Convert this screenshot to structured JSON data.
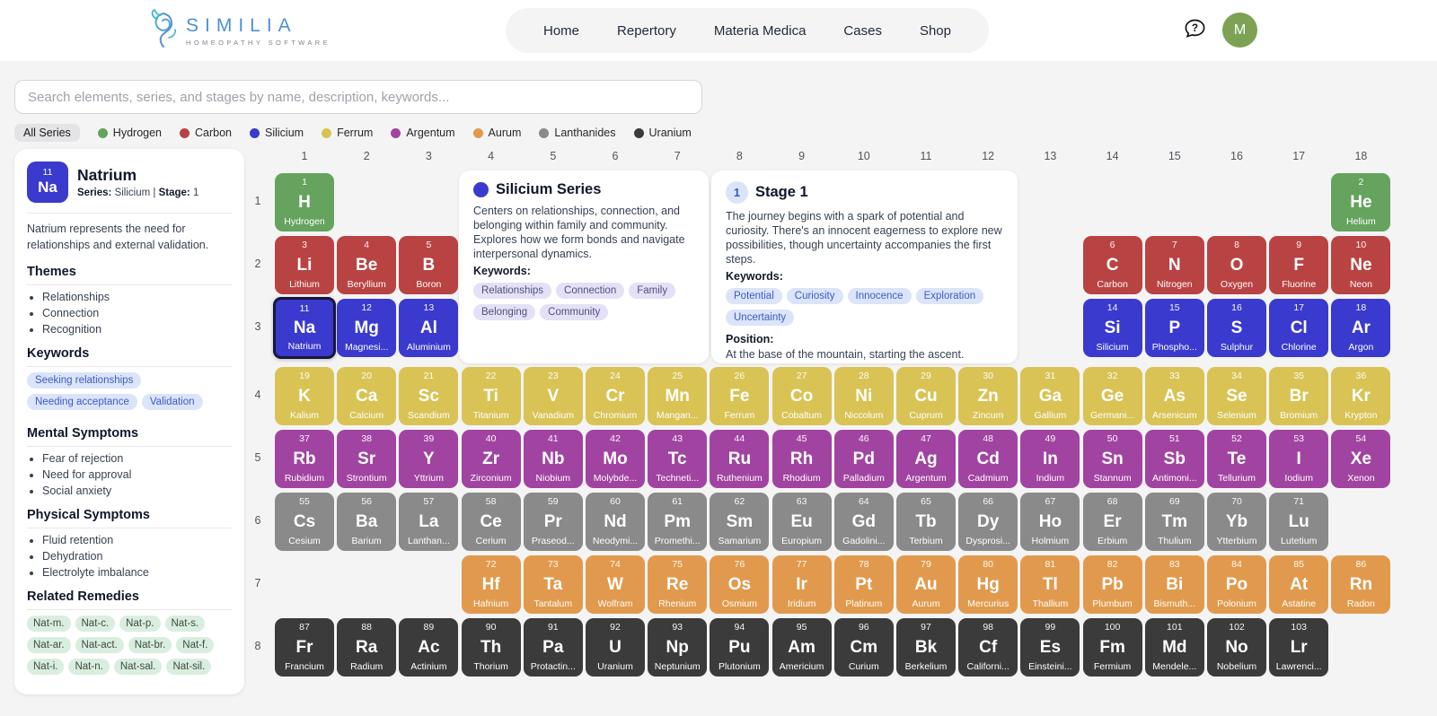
{
  "header": {
    "logo_title": "SIMILIA",
    "logo_subtitle": "HOMEOPATHY SOFTWARE",
    "nav": [
      "Home",
      "Repertory",
      "Materia Medica",
      "Cases",
      "Shop"
    ],
    "help_icon": "question-bubble",
    "avatar_initial": "M",
    "avatar_color": "#7da253"
  },
  "search": {
    "placeholder": "Search elements, series, and stages by name, description, keywords..."
  },
  "legend": {
    "all_label": "All Series",
    "series": [
      {
        "name": "Hydrogen",
        "color": "#65a35f"
      },
      {
        "name": "Carbon",
        "color": "#b94343"
      },
      {
        "name": "Silicium",
        "color": "#3a3ace"
      },
      {
        "name": "Ferrum",
        "color": "#d9c355"
      },
      {
        "name": "Argentum",
        "color": "#a144a1"
      },
      {
        "name": "Aurum",
        "color": "#e19a4d"
      },
      {
        "name": "Lanthanides",
        "color": "#8a8a8a"
      },
      {
        "name": "Uranium",
        "color": "#3b3b3b"
      }
    ]
  },
  "detail_panel": {
    "number": "11",
    "symbol": "Na",
    "name": "Natrium",
    "series_label": "Series:",
    "series_value": "Silicium",
    "separator": "|",
    "stage_label": "Stage:",
    "stage_value": "1",
    "description": "Natrium represents the need for relationships and external validation.",
    "themes_title": "Themes",
    "themes": [
      "Relationships",
      "Connection",
      "Recognition"
    ],
    "keywords_title": "Keywords",
    "keywords": [
      "Seeking relationships",
      "Needing acceptance",
      "Validation"
    ],
    "mental_title": "Mental Symptoms",
    "mental": [
      "Fear of rejection",
      "Need for approval",
      "Social anxiety"
    ],
    "physical_title": "Physical Symptoms",
    "physical": [
      "Fluid retention",
      "Dehydration",
      "Electrolyte imbalance"
    ],
    "remedies_title": "Related Remedies",
    "remedies": [
      "Nat-m.",
      "Nat-c.",
      "Nat-p.",
      "Nat-s.",
      "Nat-ar.",
      "Nat-act.",
      "Nat-br.",
      "Nat-f.",
      "Nat-i.",
      "Nat-n.",
      "Nat-sal.",
      "Nat-sil."
    ]
  },
  "series_card": {
    "dot_color": "#3a3ace",
    "title": "Silicium Series",
    "description": "Centers on relationships, connection, and belonging within family and community. Explores how we form bonds and navigate interpersonal dynamics.",
    "keywords_label": "Keywords:",
    "keywords": [
      "Relationships",
      "Connection",
      "Family",
      "Belonging",
      "Community"
    ]
  },
  "stage_card": {
    "badge": "1",
    "title": "Stage 1",
    "description": "The journey begins with a spark of potential and curiosity. There's an innocent eagerness to explore new possibilities, though uncertainty accompanies the first steps.",
    "keywords_label": "Keywords:",
    "keywords": [
      "Potential",
      "Curiosity",
      "Innocence",
      "Exploration",
      "Uncertainty"
    ],
    "position_label": "Position:",
    "position": "At the base of the mountain, starting the ascent."
  },
  "table": {
    "col_headers": [
      "1",
      "2",
      "3",
      "4",
      "5",
      "6",
      "7",
      "8",
      "9",
      "10",
      "11",
      "12",
      "13",
      "14",
      "15",
      "16",
      "17",
      "18"
    ],
    "row_headers": [
      "1",
      "2",
      "3",
      "4",
      "5",
      "6",
      "7",
      "8"
    ],
    "series_colors": {
      "hydrogen": "#65a35f",
      "carbon": "#b94343",
      "silicium": "#3a3ace",
      "ferrum": "#d9c355",
      "argentum": "#a144a1",
      "lanthanides": "#8a8a8a",
      "aurum": "#e19a4d",
      "uranium": "#3b3b3b"
    },
    "selected": "Na",
    "element_fields": [
      "number",
      "symbol",
      "name",
      "row",
      "col",
      "series"
    ],
    "elements": [
      [
        1,
        "H",
        "Hydrogen",
        1,
        1,
        "hydrogen"
      ],
      [
        2,
        "He",
        "Helium",
        1,
        18,
        "hydrogen"
      ],
      [
        3,
        "Li",
        "Lithium",
        2,
        1,
        "carbon"
      ],
      [
        4,
        "Be",
        "Beryllium",
        2,
        2,
        "carbon"
      ],
      [
        5,
        "B",
        "Boron",
        2,
        3,
        "carbon"
      ],
      [
        6,
        "C",
        "Carbon",
        2,
        14,
        "carbon"
      ],
      [
        7,
        "N",
        "Nitrogen",
        2,
        15,
        "carbon"
      ],
      [
        8,
        "O",
        "Oxygen",
        2,
        16,
        "carbon"
      ],
      [
        9,
        "F",
        "Fluorine",
        2,
        17,
        "carbon"
      ],
      [
        10,
        "Ne",
        "Neon",
        2,
        18,
        "carbon"
      ],
      [
        11,
        "Na",
        "Natrium",
        3,
        1,
        "silicium"
      ],
      [
        12,
        "Mg",
        "Magnesi...",
        3,
        2,
        "silicium"
      ],
      [
        13,
        "Al",
        "Aluminium",
        3,
        3,
        "silicium"
      ],
      [
        14,
        "Si",
        "Silicium",
        3,
        14,
        "silicium"
      ],
      [
        15,
        "P",
        "Phospho...",
        3,
        15,
        "silicium"
      ],
      [
        16,
        "S",
        "Sulphur",
        3,
        16,
        "silicium"
      ],
      [
        17,
        "Cl",
        "Chlorine",
        3,
        17,
        "silicium"
      ],
      [
        18,
        "Ar",
        "Argon",
        3,
        18,
        "silicium"
      ],
      [
        19,
        "K",
        "Kalium",
        4,
        1,
        "ferrum"
      ],
      [
        20,
        "Ca",
        "Calcium",
        4,
        2,
        "ferrum"
      ],
      [
        21,
        "Sc",
        "Scandium",
        4,
        3,
        "ferrum"
      ],
      [
        22,
        "Ti",
        "Titanium",
        4,
        4,
        "ferrum"
      ],
      [
        23,
        "V",
        "Vanadium",
        4,
        5,
        "ferrum"
      ],
      [
        24,
        "Cr",
        "Chromium",
        4,
        6,
        "ferrum"
      ],
      [
        25,
        "Mn",
        "Mangan...",
        4,
        7,
        "ferrum"
      ],
      [
        26,
        "Fe",
        "Ferrum",
        4,
        8,
        "ferrum"
      ],
      [
        27,
        "Co",
        "Cobaltum",
        4,
        9,
        "ferrum"
      ],
      [
        28,
        "Ni",
        "Niccolum",
        4,
        10,
        "ferrum"
      ],
      [
        29,
        "Cu",
        "Cuprum",
        4,
        11,
        "ferrum"
      ],
      [
        30,
        "Zn",
        "Zincum",
        4,
        12,
        "ferrum"
      ],
      [
        31,
        "Ga",
        "Gallium",
        4,
        13,
        "ferrum"
      ],
      [
        32,
        "Ge",
        "Germani...",
        4,
        14,
        "ferrum"
      ],
      [
        33,
        "As",
        "Arsenicum",
        4,
        15,
        "ferrum"
      ],
      [
        34,
        "Se",
        "Selenium",
        4,
        16,
        "ferrum"
      ],
      [
        35,
        "Br",
        "Bromium",
        4,
        17,
        "ferrum"
      ],
      [
        36,
        "Kr",
        "Krypton",
        4,
        18,
        "ferrum"
      ],
      [
        37,
        "Rb",
        "Rubidium",
        5,
        1,
        "argentum"
      ],
      [
        38,
        "Sr",
        "Strontium",
        5,
        2,
        "argentum"
      ],
      [
        39,
        "Y",
        "Yttrium",
        5,
        3,
        "argentum"
      ],
      [
        40,
        "Zr",
        "Zirconium",
        5,
        4,
        "argentum"
      ],
      [
        41,
        "Nb",
        "Niobium",
        5,
        5,
        "argentum"
      ],
      [
        42,
        "Mo",
        "Molybde...",
        5,
        6,
        "argentum"
      ],
      [
        43,
        "Tc",
        "Techneti...",
        5,
        7,
        "argentum"
      ],
      [
        44,
        "Ru",
        "Ruthenium",
        5,
        8,
        "argentum"
      ],
      [
        45,
        "Rh",
        "Rhodium",
        5,
        9,
        "argentum"
      ],
      [
        46,
        "Pd",
        "Palladium",
        5,
        10,
        "argentum"
      ],
      [
        47,
        "Ag",
        "Argentum",
        5,
        11,
        "argentum"
      ],
      [
        48,
        "Cd",
        "Cadmium",
        5,
        12,
        "argentum"
      ],
      [
        49,
        "In",
        "Indium",
        5,
        13,
        "argentum"
      ],
      [
        50,
        "Sn",
        "Stannum",
        5,
        14,
        "argentum"
      ],
      [
        51,
        "Sb",
        "Antimoni...",
        5,
        15,
        "argentum"
      ],
      [
        52,
        "Te",
        "Tellurium",
        5,
        16,
        "argentum"
      ],
      [
        53,
        "I",
        "Iodium",
        5,
        17,
        "argentum"
      ],
      [
        54,
        "Xe",
        "Xenon",
        5,
        18,
        "argentum"
      ],
      [
        55,
        "Cs",
        "Cesium",
        6,
        1,
        "lanthanides"
      ],
      [
        56,
        "Ba",
        "Barium",
        6,
        2,
        "lanthanides"
      ],
      [
        57,
        "La",
        "Lanthan...",
        6,
        3,
        "lanthanides"
      ],
      [
        58,
        "Ce",
        "Cerium",
        6,
        4,
        "lanthanides"
      ],
      [
        59,
        "Pr",
        "Praseod...",
        6,
        5,
        "lanthanides"
      ],
      [
        60,
        "Nd",
        "Neodymi...",
        6,
        6,
        "lanthanides"
      ],
      [
        61,
        "Pm",
        "Promethi...",
        6,
        7,
        "lanthanides"
      ],
      [
        62,
        "Sm",
        "Samarium",
        6,
        8,
        "lanthanides"
      ],
      [
        63,
        "Eu",
        "Europium",
        6,
        9,
        "lanthanides"
      ],
      [
        64,
        "Gd",
        "Gadolini...",
        6,
        10,
        "lanthanides"
      ],
      [
        65,
        "Tb",
        "Terbium",
        6,
        11,
        "lanthanides"
      ],
      [
        66,
        "Dy",
        "Dysprosi...",
        6,
        12,
        "lanthanides"
      ],
      [
        67,
        "Ho",
        "Holmium",
        6,
        13,
        "lanthanides"
      ],
      [
        68,
        "Er",
        "Erbium",
        6,
        14,
        "lanthanides"
      ],
      [
        69,
        "Tm",
        "Thulium",
        6,
        15,
        "lanthanides"
      ],
      [
        70,
        "Yb",
        "Ytterbium",
        6,
        16,
        "lanthanides"
      ],
      [
        71,
        "Lu",
        "Lutetium",
        6,
        17,
        "lanthanides"
      ],
      [
        72,
        "Hf",
        "Hafnium",
        7,
        4,
        "aurum"
      ],
      [
        73,
        "Ta",
        "Tantalum",
        7,
        5,
        "aurum"
      ],
      [
        74,
        "W",
        "Wolfram",
        7,
        6,
        "aurum"
      ],
      [
        75,
        "Re",
        "Rhenium",
        7,
        7,
        "aurum"
      ],
      [
        76,
        "Os",
        "Osmium",
        7,
        8,
        "aurum"
      ],
      [
        77,
        "Ir",
        "Iridium",
        7,
        9,
        "aurum"
      ],
      [
        78,
        "Pt",
        "Platinum",
        7,
        10,
        "aurum"
      ],
      [
        79,
        "Au",
        "Aurum",
        7,
        11,
        "aurum"
      ],
      [
        80,
        "Hg",
        "Mercurius",
        7,
        12,
        "aurum"
      ],
      [
        81,
        "Tl",
        "Thallium",
        7,
        13,
        "aurum"
      ],
      [
        82,
        "Pb",
        "Plumbum",
        7,
        14,
        "aurum"
      ],
      [
        83,
        "Bi",
        "Bismuth...",
        7,
        15,
        "aurum"
      ],
      [
        84,
        "Po",
        "Polonium",
        7,
        16,
        "aurum"
      ],
      [
        85,
        "At",
        "Astatine",
        7,
        17,
        "aurum"
      ],
      [
        86,
        "Rn",
        "Radon",
        7,
        18,
        "aurum"
      ],
      [
        87,
        "Fr",
        "Francium",
        8,
        1,
        "uranium"
      ],
      [
        88,
        "Ra",
        "Radium",
        8,
        2,
        "uranium"
      ],
      [
        89,
        "Ac",
        "Actinium",
        8,
        3,
        "uranium"
      ],
      [
        90,
        "Th",
        "Thorium",
        8,
        4,
        "uranium"
      ],
      [
        91,
        "Pa",
        "Protactin...",
        8,
        5,
        "uranium"
      ],
      [
        92,
        "U",
        "Uranium",
        8,
        6,
        "uranium"
      ],
      [
        93,
        "Np",
        "Neptunium",
        8,
        7,
        "uranium"
      ],
      [
        94,
        "Pu",
        "Plutonium",
        8,
        8,
        "uranium"
      ],
      [
        95,
        "Am",
        "Americium",
        8,
        9,
        "uranium"
      ],
      [
        96,
        "Cm",
        "Curium",
        8,
        10,
        "uranium"
      ],
      [
        97,
        "Bk",
        "Berkelium",
        8,
        11,
        "uranium"
      ],
      [
        98,
        "Cf",
        "Californi...",
        8,
        12,
        "uranium"
      ],
      [
        99,
        "Es",
        "Einsteini...",
        8,
        13,
        "uranium"
      ],
      [
        100,
        "Fm",
        "Fermium",
        8,
        14,
        "uranium"
      ],
      [
        101,
        "Md",
        "Mendele...",
        8,
        15,
        "uranium"
      ],
      [
        102,
        "No",
        "Nobelium",
        8,
        16,
        "uranium"
      ],
      [
        103,
        "Lr",
        "Lawrenci...",
        8,
        17,
        "uranium"
      ]
    ]
  }
}
